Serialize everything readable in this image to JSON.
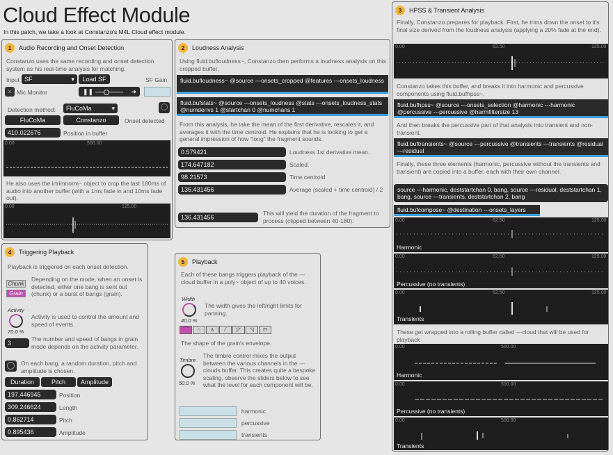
{
  "title": "Cloud Effect Module",
  "subtitle": "In this patch, we take a look at Constanzo's M4L Cloud effect module.",
  "p1": {
    "num": "1",
    "title": "Audio Recording and Onset Detection",
    "desc": "Constanzo uses the same recording and onset detection system as his real-time analysis for matching.",
    "input_label": "Input",
    "input_value": "SF",
    "load_sf": "Load SF",
    "sf_gain": "SF Gain",
    "mic_monitor": "Mic Monitor",
    "detection_label": "Detection method:",
    "detection_value": "FluCoMa",
    "btn_flucoma": "FluCoMa",
    "btn_constanzo": "Constanzo",
    "onset_detected": "Onset detected",
    "position_value": "410.022676",
    "position_label": "Position in buffer",
    "wave1_t0": "0.00",
    "wave1_t1": "500.00",
    "desc2": "He also uses the irtrimnorm~ object to crop the last 180ms of audio into another buffer (with a 1ms fade in and 10ms fade out).",
    "wave2_t0": "0.00",
    "wave2_t1": "125.00"
  },
  "p2": {
    "num": "2",
    "title": "Loudness Analysis",
    "desc": "Using fluid.bufloudness~, Constanzo then performs a loudness analysis on this cropped buffer.",
    "msg1": "fluid.bufloudness~ @source ---onsets_cropped @features ---onsets_loudness",
    "msg2": "fluid.bufstats~ @source ---onsets_loudness @stats ---onsets_loudness_stats @numderivs 1 @startchan 0 @numchans 1",
    "desc2": "From this analysis, he take the mean of the first derivative, rescales it, and averages it with the time centroid. He explains that he is looking to get a general impression of how \"long\" the fragment sounds.",
    "rows": [
      {
        "value": "0.579421",
        "label": "Loudness 1st derivative mean."
      },
      {
        "value": "174.647182",
        "label": "Scaled."
      },
      {
        "value": "98.21573",
        "label": "Time centroid"
      },
      {
        "value": "136.431456",
        "label": "Average (scaled + time centroid) / 2"
      }
    ],
    "final_value": "136.431456",
    "final_label": "This will yield the duration of the fragment to process (clipped between 40-180)."
  },
  "p3": {
    "num": "3",
    "title": "HPSS & Transient Analysis",
    "desc": "Finally, Constanzo prepares for playback. First, he trims down the onset to it's final size derived from the loudness analysis (applying a 20% fade at the end).",
    "w_t0": "0.00",
    "w_t1": "62.50",
    "w_t2": "125.00",
    "desc2": "Constanzo takes this buffer, and breaks it into harmonic and percussive components using fluid.bufhpss~.",
    "msg1": "fluid.bufhpss~ @source ---onsets_selection @harmonic ---harmonic @percussive ---percussive @harmfiltersize 13",
    "desc3": "And then breaks the percussive part of that analysis into transient and non-transient.",
    "msg2": "fluid.buftransients~ @source ---percussive @transients ---transients @residual ---residual",
    "desc4": "Finally, these three elements (harmonic, percussive without the transients and transient) are copied into a buffer, each with their own channel.",
    "msg3": "source ---harmonic, deststartchan 0, bang, source ---residual, deststartchan 1, bang, source ---transients, deststartchan 2, bang",
    "msg4": "fluid.bufcompose~ @destination ---onsets_layers",
    "lab_h": "Harmonic",
    "lab_p": "Percussive (no transients)",
    "lab_t": "Transients",
    "desc5": "These get wrapped into a rolling buffer called ---cloud that will be used for playback",
    "r_t0": "0.00",
    "r_t1": "500.00"
  },
  "p4": {
    "num": "4",
    "title": "Triggering Playback",
    "desc": "Playback is triggered on each onset detection.",
    "chunk": "Chunk",
    "grain": "Grain",
    "desc_mode": "Depending on the mode, when an onset is detected, either one bang is sent out (chunk) or a burst of bangs (grain).",
    "activity": "Activity",
    "activity_val": "70.0 %",
    "desc_act": "Activity is used to control the amount and speed of events.",
    "count": "3",
    "desc_cnt": "The number and speed of bangs in grain mode depends on the activity parameter.",
    "desc_rand": "On each bang, a random duration, pitch and amplitude is chosen.",
    "hdr": [
      "Duration",
      "Pitch",
      "Amplitude"
    ],
    "rows": [
      {
        "value": "197.446945",
        "label": "Position"
      },
      {
        "value": "309.246624",
        "label": "Length"
      },
      {
        "value": "0.862714",
        "label": "Pitch"
      },
      {
        "value": "0.895436",
        "label": "Amplitude"
      }
    ]
  },
  "p5": {
    "num": "5",
    "title": "Playback",
    "desc": "Each of these bangs triggers playback of the ---cloud buffer in a poly~ object of up to 40 voices.",
    "width": "Width",
    "width_val": "40.0 %",
    "desc_w": "The width gives the left/right limits for panning.",
    "desc_env": "The shape of the grain's envelope.",
    "timbre": "Timbre",
    "timbre_val": "50.0 %",
    "desc_t": "The timbre control mixes the output between the various channels in the ---clouds buffer. This creates quite a bespoke scaling, observe the sliders below to see what the level for each component will be.",
    "sliders": [
      "harmonic",
      "percussive",
      "transients"
    ]
  },
  "colors": {
    "accent": "#3aa0df",
    "badge": "#f3b63d",
    "grain": "#c04fb0"
  }
}
